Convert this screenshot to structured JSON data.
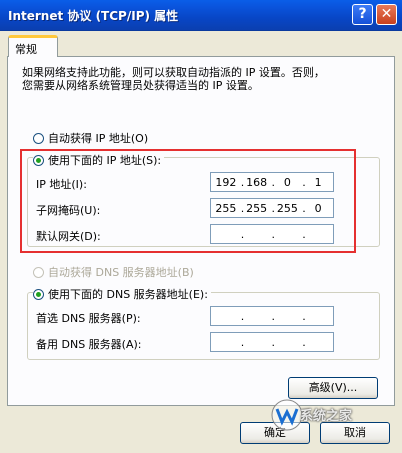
{
  "window": {
    "title": "Internet 协议 (TCP/IP) 属性",
    "help_glyph": "?",
    "close_glyph": "✕"
  },
  "tabs": {
    "general": "常规"
  },
  "description": "如果网络支持此功能，则可以获取自动指派的 IP 设置。否则，\n您需要从网络系统管理员处获得适当的 IP 设置。",
  "ip_section": {
    "auto_label": "自动获得 IP 地址(O)",
    "manual_label": "使用下面的 IP 地址(S):",
    "selected": "manual",
    "fields": [
      {
        "label": "IP 地址(I):",
        "value": [
          "192",
          "168",
          "0",
          "1"
        ]
      },
      {
        "label": "子网掩码(U):",
        "value": [
          "255",
          "255",
          "255",
          "0"
        ]
      },
      {
        "label": "默认网关(D):",
        "value": [
          "",
          "",
          "",
          ""
        ]
      }
    ]
  },
  "dns_section": {
    "auto_label": "自动获得 DNS 服务器地址(B)",
    "manual_label": "使用下面的 DNS 服务器地址(E):",
    "selected": "manual",
    "fields": [
      {
        "label": "首选 DNS 服务器(P):",
        "value": [
          "",
          "",
          "",
          ""
        ]
      },
      {
        "label": "备用 DNS 服务器(A):",
        "value": [
          "",
          "",
          "",
          ""
        ]
      }
    ]
  },
  "buttons": {
    "advanced": "高级(V)...",
    "ok": "确定",
    "cancel": "取消"
  },
  "watermark": {
    "text": "系统之家"
  },
  "colors": {
    "titlebar": "#0a55de",
    "highlight_box": "#e53030",
    "dialog_bg": "#ece9d8"
  }
}
